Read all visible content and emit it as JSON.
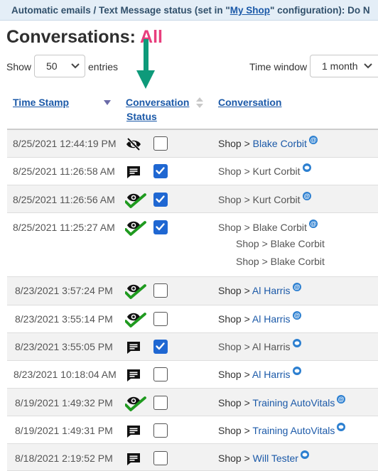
{
  "banner": {
    "prefix": "Automatic emails / Text Message status (set in \"",
    "link": "My Shop",
    "suffix": "\" configuration): Do N"
  },
  "page": {
    "title": "Conversations:",
    "filter": "All"
  },
  "controls": {
    "show_label": "Show",
    "entries_value": "50",
    "entries_label": "entries",
    "time_window_label": "Time window",
    "time_window_value": "1 month"
  },
  "table": {
    "headers": {
      "timestamp": "Time Stamp",
      "status_line1": "Conversation",
      "status_line2": "Status",
      "conversation": "Conversation"
    },
    "rows": [
      {
        "timestamp": "8/25/2021 12:44:19 PM",
        "status_icon": "eye-slash-icon",
        "checked": false,
        "prefix": "Shop >",
        "name": "Blake Corbit",
        "name_link": true,
        "badge": "email"
      },
      {
        "timestamp": "8/25/2021 11:26:58 AM",
        "status_icon": "message-icon",
        "checked": true,
        "prefix": "Shop > Kurt Corbit",
        "name": "",
        "name_link": false,
        "badge": "sms"
      },
      {
        "timestamp": "8/25/2021 11:26:56 AM",
        "status_icon": "eye-check-icon",
        "checked": true,
        "prefix": "Shop > Kurt Corbit",
        "name": "",
        "name_link": false,
        "badge": "email"
      },
      {
        "timestamp": "8/25/2021 11:25:27 AM",
        "status_icon": "eye-check-icon",
        "checked": true,
        "prefix": "Shop > Blake Corbit",
        "name": "",
        "name_link": false,
        "badge": "email",
        "extra": [
          "Shop > Blake Corbit",
          "Shop > Blake Corbit"
        ]
      },
      {
        "timestamp": "8/23/2021 3:57:24 PM",
        "status_icon": "eye-check-icon",
        "checked": false,
        "prefix": "Shop >",
        "name": "Al Harris",
        "name_link": true,
        "badge": "email"
      },
      {
        "timestamp": "8/23/2021 3:55:14 PM",
        "status_icon": "eye-check-icon",
        "checked": false,
        "prefix": "Shop >",
        "name": "Al Harris",
        "name_link": true,
        "badge": "email"
      },
      {
        "timestamp": "8/23/2021 3:55:05 PM",
        "status_icon": "message-icon",
        "checked": true,
        "prefix": "Shop > Al Harris",
        "name": "",
        "name_link": false,
        "badge": "sms"
      },
      {
        "timestamp": "8/23/2021 10:18:04 AM",
        "status_icon": "message-icon",
        "checked": false,
        "prefix": "Shop >",
        "name": "Al Harris",
        "name_link": true,
        "badge": "sms"
      },
      {
        "timestamp": "8/19/2021 1:49:32 PM",
        "status_icon": "eye-check-icon",
        "checked": false,
        "prefix": "Shop >",
        "name": "Training AutoVitals",
        "name_link": true,
        "badge": "email"
      },
      {
        "timestamp": "8/19/2021 1:49:31 PM",
        "status_icon": "message-icon",
        "checked": false,
        "prefix": "Shop >",
        "name": "Training AutoVitals",
        "name_link": true,
        "badge": "sms"
      },
      {
        "timestamp": "8/18/2021 2:19:52 PM",
        "status_icon": "message-icon",
        "checked": false,
        "prefix": "Shop >",
        "name": "Will Tester",
        "name_link": true,
        "badge": "sms"
      }
    ]
  },
  "colors": {
    "link": "#1b59a8",
    "accent_all": "#e83e7d",
    "checkbox_on": "#1f67d2",
    "check_green": "#1f9a1f",
    "arrow_teal": "#0e9a7a",
    "banner_bg": "#e4eef7"
  }
}
